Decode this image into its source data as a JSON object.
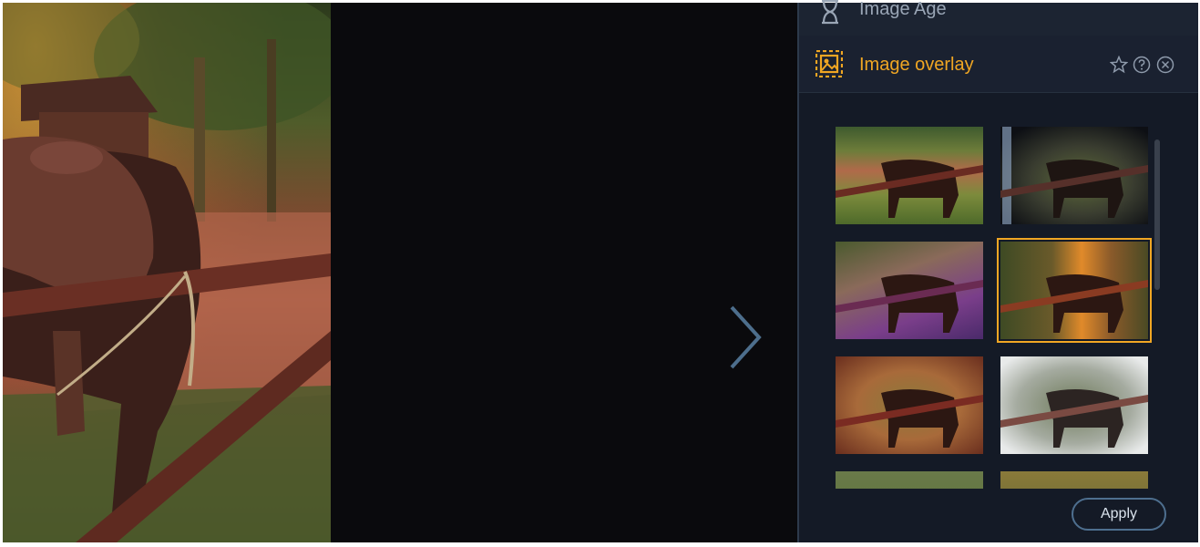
{
  "panel": {
    "previous_tool": {
      "label": "Image Age",
      "icon": "hourglass-icon"
    },
    "tool": {
      "label": "Image overlay",
      "icon": "image-overlay-icon",
      "accent": "#f0a623"
    },
    "header_buttons": {
      "favorite_icon": "star-icon",
      "help_icon": "help-icon",
      "close_icon": "close-icon"
    },
    "apply_label": "Apply",
    "thumbnails": [
      {
        "style": "natural",
        "selected": false
      },
      {
        "style": "light-leak-blue",
        "selected": false
      },
      {
        "style": "purple-glow",
        "selected": false
      },
      {
        "style": "orange-flare",
        "selected": true
      },
      {
        "style": "warm-vintage",
        "selected": false
      },
      {
        "style": "faded-white",
        "selected": false
      },
      {
        "style": "partial-1",
        "selected": false
      },
      {
        "style": "partial-2",
        "selected": false
      }
    ]
  },
  "canvas": {
    "next_icon": "chevron-right-icon"
  },
  "colors": {
    "panel_bg": "#141a26",
    "accent": "#f0a623",
    "canvas_bg": "#0a0a0d"
  }
}
